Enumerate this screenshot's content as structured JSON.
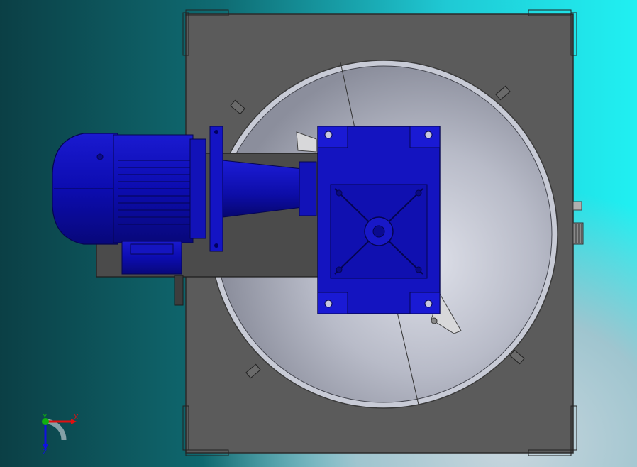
{
  "viewport": {
    "background_colors": [
      "#0b3f45",
      "#20f0f2",
      "#c9d6de"
    ]
  },
  "model": {
    "frame_color": "#5a5a5a",
    "bowl_color": "#b9bcc8",
    "motor_color": "#1010b8",
    "gearbox_color": "#1414c0"
  },
  "triad": {
    "x_label": "X",
    "y_label": "Y",
    "z_label": "Z",
    "x_color": "#e01010",
    "y_color": "#10b010",
    "z_color": "#1010e0"
  }
}
